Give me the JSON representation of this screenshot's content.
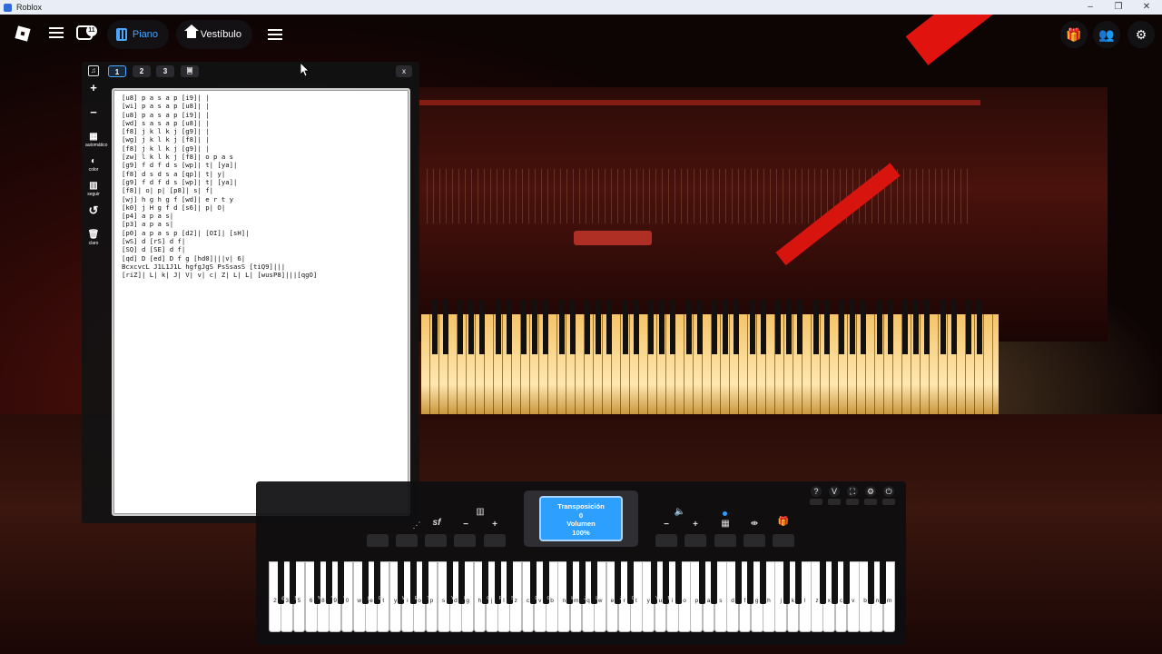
{
  "window": {
    "title": "Roblox",
    "minimize": "–",
    "restore": "❐",
    "close": "✕"
  },
  "topbar": {
    "chat_badge": "11",
    "tabs": [
      {
        "label": "Piano",
        "icon": "piano-icon",
        "active": true
      },
      {
        "label": "Vestíbulo",
        "icon": "home-icon",
        "active": false
      }
    ],
    "right_icons": [
      "gift-icon",
      "friends-icon",
      "settings-icon"
    ]
  },
  "sheet": {
    "tabs": [
      "1",
      "2",
      "3",
      "🗏"
    ],
    "active_tab": "1",
    "close_label": "x",
    "tools": [
      {
        "icon": "plus-icon",
        "glyph": "+",
        "label": ""
      },
      {
        "icon": "minus-icon",
        "glyph": "−",
        "label": ""
      },
      {
        "icon": "auto-icon",
        "glyph": "▦",
        "label": "automático"
      },
      {
        "icon": "color-icon",
        "glyph": "◐",
        "label": "color"
      },
      {
        "icon": "follow-icon",
        "glyph": "▥",
        "label": "seguir"
      },
      {
        "icon": "reset-icon",
        "glyph": "↺",
        "label": ""
      },
      {
        "icon": "clear-icon",
        "glyph": "🗑",
        "label": "claro"
      }
    ],
    "lines": [
      "[u8] p a s a p [i9]| |",
      "[wi] p a s a p [u8]| |",
      "[u8] p a s a p [i9]| |",
      "[wd] s a s a p [u8]| |",
      "[f8] j k l k j [g9]| |",
      "[wg] j k l k j [f8]| |",
      "[f8] j k l k j [g9]| |",
      "[zw] l k l k j [f8]| o p a s",
      "[g9] f d f d s [wp]| t| [ya]|",
      "[f8] d s d s a [qp]| t| y|",
      "[g9] f d f d s [wp]| t| [ya]|",
      "[f8]| o| p| [p8]| s| f|",
      "[wj] h g h g f [wd]| e r t y",
      "[k0] j H g f d [s6]| p| O|",
      "[p4] a p a s|",
      "[p3] a p a s|",
      "[p0] a p a s p [d2]| [OI]| [sH]|",
      "[wS] d [rS] d f|",
      "[SQ] d [SE] d f|",
      "[qd] D [ed] D f g [hd0]|||v| 6|",
      "BcxcvcL J1L1J1L hgfgJgS PsSsasS [tiQ9]|||",
      "[riZ]| L| k| J| V| v| c| Z| L| L| [wusP8]|||[qgO]"
    ]
  },
  "keyboard": {
    "display": {
      "line1": "Transposición",
      "line2": "0",
      "line3": "Volumen",
      "line4": "100%"
    },
    "top_right_icons": [
      {
        "name": "help-icon",
        "glyph": "?"
      },
      {
        "name": "version-icon",
        "glyph": "V"
      },
      {
        "name": "fullscreen-icon",
        "glyph": "⛶"
      },
      {
        "name": "settings-icon",
        "glyph": "⚙"
      },
      {
        "name": "power-icon",
        "glyph": "⏻"
      }
    ],
    "left_controls": [
      {
        "name": "sustain-icon",
        "glyph": "sf"
      },
      {
        "name": "transpose-minus",
        "glyph": "−"
      },
      {
        "name": "transpose-plus",
        "glyph": "+"
      },
      {
        "name": "piano-layout-icon",
        "glyph": "▥"
      }
    ],
    "right_controls": [
      {
        "name": "volume-minus",
        "glyph": "−"
      },
      {
        "name": "volume-plus",
        "glyph": "+"
      },
      {
        "name": "speaker-icon",
        "glyph": "🔈"
      },
      {
        "name": "calculator-icon",
        "glyph": "▦"
      },
      {
        "name": "midi-icon",
        "glyph": "⇼"
      },
      {
        "name": "gift-icon",
        "glyph": "🎁"
      }
    ],
    "white_labels": [
      "2",
      "3",
      "5",
      "6",
      "8",
      "9",
      "0",
      "w",
      "e",
      "t",
      "y",
      "i",
      "o",
      "p",
      "s",
      "d",
      "g",
      "h",
      "j",
      "l",
      "z",
      "c",
      "v",
      "b",
      "n",
      "m",
      "q",
      "w",
      "e",
      "r",
      "t",
      "y",
      "u",
      "i",
      "o",
      "p",
      "a",
      "s",
      "d",
      "f",
      "g",
      "h",
      "j",
      "k",
      "l",
      "z",
      "x",
      "c",
      "v",
      "b",
      "n",
      "m"
    ],
    "black_labels": [
      "@",
      "$",
      "%",
      "^",
      "*",
      "(",
      "Q",
      "W",
      "E",
      "T",
      "Y",
      "I",
      "O",
      "P",
      "S",
      "D",
      "G",
      "H",
      "J",
      "L",
      "Z",
      "C",
      "V",
      "B"
    ]
  }
}
